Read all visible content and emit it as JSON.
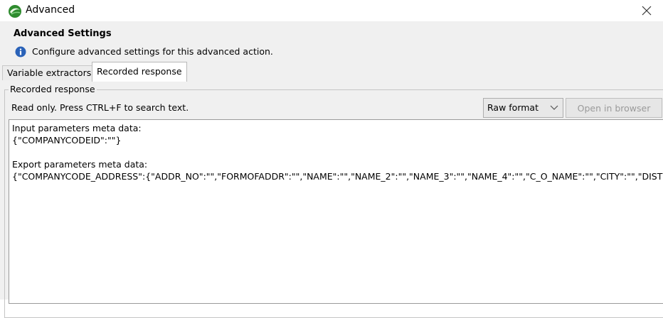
{
  "window": {
    "title": "Advanced",
    "close_label": "×"
  },
  "header": {
    "title": "Advanced Settings",
    "description": "Configure advanced settings for this advanced action."
  },
  "tabs": [
    {
      "label": "Variable extractors",
      "active": false
    },
    {
      "label": "Recorded response",
      "active": true
    }
  ],
  "group": {
    "legend": "Recorded response",
    "readonly_text": "Read only. Press CTRL+F to search text.",
    "format_select": {
      "value": "Raw format"
    },
    "open_browser_label": "Open in browser"
  },
  "response": {
    "lines": [
      "Input parameters meta data:",
      "{\"COMPANYCODEID\":\"\"}",
      "",
      "Export parameters meta data:",
      "{\"COMPANYCODE_ADDRESS\":{\"ADDR_NO\":\"\",\"FORMOFADDR\":\"\",\"NAME\":\"\",\"NAME_2\":\"\",\"NAME_3\":\"\",\"NAME_4\":\"\",\"C_O_NAME\":\"\",\"CITY\":\"\",\"DISTRIC"
    ]
  },
  "colors": {
    "accent_green": "#3a9a3a",
    "info_blue": "#2a62b8"
  }
}
